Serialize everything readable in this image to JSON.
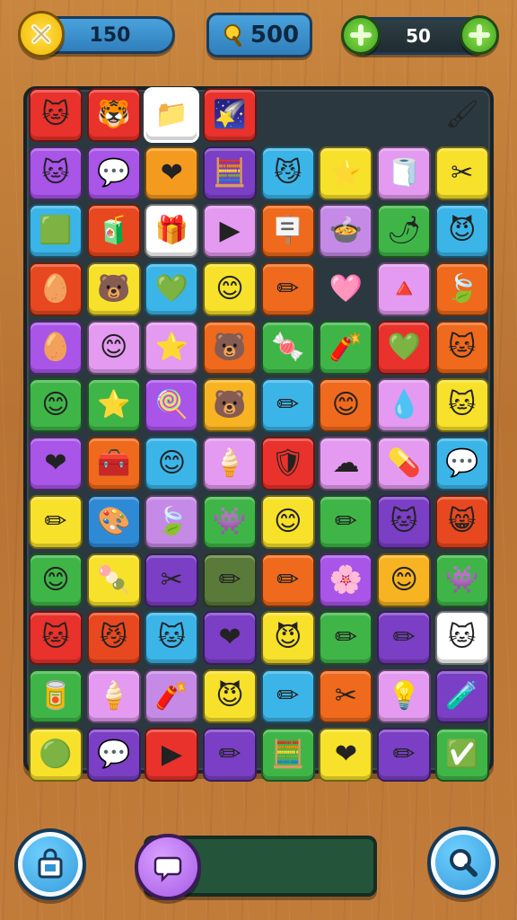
{
  "hud": {
    "score_value": "150",
    "coins_value": "500",
    "counter_value": "50",
    "score_icon": "close-icon",
    "coins_icon": "lollipop-icon"
  },
  "board": {
    "tiles": [
      {
        "c": "#e8322b",
        "g": "🐱"
      },
      {
        "c": "#e8322b",
        "g": "🐯"
      },
      {
        "c": "#ffffff",
        "g": "📁",
        "s": true
      },
      {
        "c": "#e8322b",
        "g": "🌠"
      },
      {
        "c": "",
        "g": ""
      },
      {
        "c": "",
        "g": ""
      },
      {
        "c": "",
        "g": ""
      },
      {
        "c": "",
        "g": "🖌"
      },
      {
        "c": "#a855e8",
        "g": "🐱"
      },
      {
        "c": "#a855e8",
        "g": "💬"
      },
      {
        "c": "#f49b1f",
        "g": "❤"
      },
      {
        "c": "#7a3fc4",
        "g": "🧮"
      },
      {
        "c": "#3bb5e8",
        "g": "😼"
      },
      {
        "c": "#f7e12a",
        "g": "⭐"
      },
      {
        "c": "#e39af0",
        "g": "🧻"
      },
      {
        "c": "#f7e12a",
        "g": "✂"
      },
      {
        "c": "#3bb5e8",
        "g": "🟩"
      },
      {
        "c": "#e8481f",
        "g": "🧃"
      },
      {
        "c": "#ffffff",
        "g": "🎁"
      },
      {
        "c": "#e39af0",
        "g": "▶"
      },
      {
        "c": "#ef6a1c",
        "g": "🪧"
      },
      {
        "c": "#c58ae6",
        "g": "🍲"
      },
      {
        "c": "#3fb548",
        "g": "🌶"
      },
      {
        "c": "#3bb5e8",
        "g": "😈"
      },
      {
        "c": "#e8481f",
        "g": "🥚"
      },
      {
        "c": "#f7e12a",
        "g": "🐻"
      },
      {
        "c": "#3bb5e8",
        "g": "💚"
      },
      {
        "c": "#f7e12a",
        "g": "😊"
      },
      {
        "c": "#ef6a1c",
        "g": "✏"
      },
      {
        "c": "",
        "g": "🩷"
      },
      {
        "c": "#e39af0",
        "g": "🔺"
      },
      {
        "c": "#ef6a1c",
        "g": "🍃"
      },
      {
        "c": "#a855e8",
        "g": "🥚"
      },
      {
        "c": "#e39af0",
        "g": "😊"
      },
      {
        "c": "#e39af0",
        "g": "⭐"
      },
      {
        "c": "#ef6a1c",
        "g": "🐻"
      },
      {
        "c": "#3fb548",
        "g": "🍬"
      },
      {
        "c": "#3fb548",
        "g": "🧨"
      },
      {
        "c": "#e8322b",
        "g": "💚"
      },
      {
        "c": "#ef6a1c",
        "g": "🐱"
      },
      {
        "c": "#3fb548",
        "g": "😊"
      },
      {
        "c": "#3fb548",
        "g": "⭐"
      },
      {
        "c": "#a855e8",
        "g": "🍭"
      },
      {
        "c": "#f7b321",
        "g": "🐻"
      },
      {
        "c": "#3bb5e8",
        "g": "✏"
      },
      {
        "c": "#ef6a1c",
        "g": "😊"
      },
      {
        "c": "#e39af0",
        "g": "💧"
      },
      {
        "c": "#f7e12a",
        "g": "🐱"
      },
      {
        "c": "#a855e8",
        "g": "❤"
      },
      {
        "c": "#ef6a1c",
        "g": "🧰"
      },
      {
        "c": "#3bb5e8",
        "g": "😊"
      },
      {
        "c": "#e39af0",
        "g": "🍦"
      },
      {
        "c": "#e8322b",
        "g": "🛡"
      },
      {
        "c": "#e39af0",
        "g": "☁"
      },
      {
        "c": "#e39af0",
        "g": "💊"
      },
      {
        "c": "#3bb5e8",
        "g": "💬"
      },
      {
        "c": "#f7e12a",
        "g": "✏"
      },
      {
        "c": "#2f8ad6",
        "g": "🎨"
      },
      {
        "c": "#c58ae6",
        "g": "🍃"
      },
      {
        "c": "#3fb548",
        "g": "👾"
      },
      {
        "c": "#f7e12a",
        "g": "😊"
      },
      {
        "c": "#3fb548",
        "g": "✏"
      },
      {
        "c": "#7a3fc4",
        "g": "🐱"
      },
      {
        "c": "#e8481f",
        "g": "😸"
      },
      {
        "c": "#3fb548",
        "g": "😊"
      },
      {
        "c": "#f7e12a",
        "g": "🍡"
      },
      {
        "c": "#7a3fc4",
        "g": "✂"
      },
      {
        "c": "#5a7a3a",
        "g": "✏"
      },
      {
        "c": "#ef6a1c",
        "g": "✏"
      },
      {
        "c": "#a855e8",
        "g": "🌸"
      },
      {
        "c": "#f7b321",
        "g": "😊"
      },
      {
        "c": "#3fb548",
        "g": "👾"
      },
      {
        "c": "#e8322b",
        "g": "🐱"
      },
      {
        "c": "#e8481f",
        "g": "😼"
      },
      {
        "c": "#3bb5e8",
        "g": "🐱"
      },
      {
        "c": "#7a3fc4",
        "g": "❤"
      },
      {
        "c": "#f7e12a",
        "g": "😈"
      },
      {
        "c": "#3fb548",
        "g": "✏"
      },
      {
        "c": "#7a3fc4",
        "g": "✏"
      },
      {
        "c": "#ffffff",
        "g": "🐱"
      },
      {
        "c": "#3fb548",
        "g": "🥫"
      },
      {
        "c": "#e39af0",
        "g": "🍦"
      },
      {
        "c": "#c58ae6",
        "g": "🧨"
      },
      {
        "c": "#f7e12a",
        "g": "😈"
      },
      {
        "c": "#3bb5e8",
        "g": "✏"
      },
      {
        "c": "#ef6a1c",
        "g": "✂"
      },
      {
        "c": "#e39af0",
        "g": "💡"
      },
      {
        "c": "#7a3fc4",
        "g": "🧪"
      },
      {
        "c": "#f7e12a",
        "g": "🟢"
      },
      {
        "c": "#7a3fc4",
        "g": "💬"
      },
      {
        "c": "#e8322b",
        "g": "▶"
      },
      {
        "c": "#7a3fc4",
        "g": "✏"
      },
      {
        "c": "#3fb548",
        "g": "🧮"
      },
      {
        "c": "#f7e12a",
        "g": "❤"
      },
      {
        "c": "#7a3fc4",
        "g": "✏"
      },
      {
        "c": "#3fb548",
        "g": "✅"
      }
    ]
  },
  "progress": {
    "fill_fraction": 0.0
  },
  "colors": {
    "gold": "#f3b700",
    "blue": "#2f95d6",
    "green": "#3fa321",
    "purple": "#a65ae6"
  }
}
